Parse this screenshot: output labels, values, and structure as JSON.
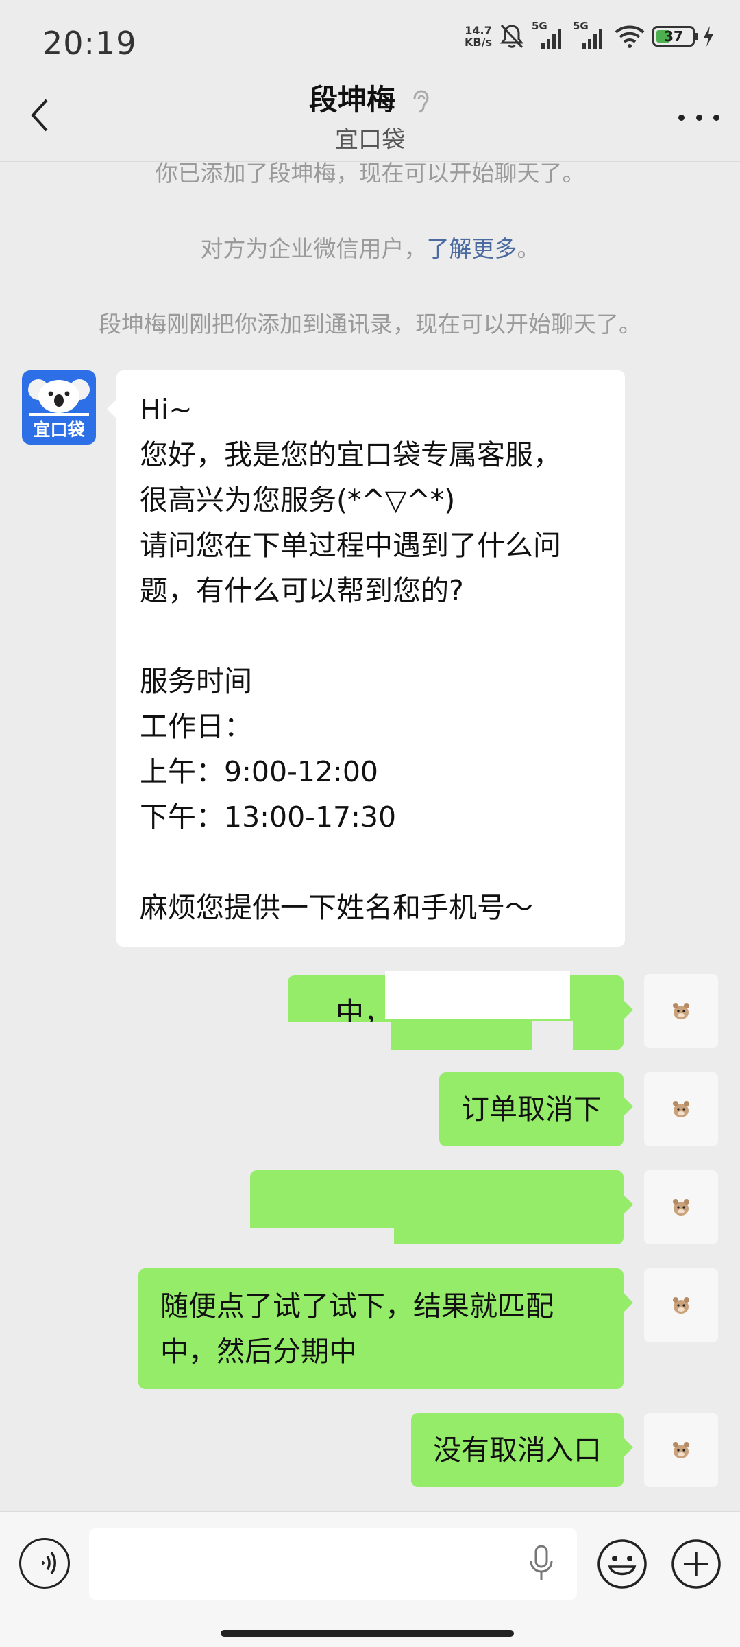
{
  "status_bar": {
    "time": "20:19",
    "net_speed_value": "14.7",
    "net_speed_unit": "KB/s",
    "signal_1_label": "5G",
    "signal_2_label": "5G",
    "battery": "37"
  },
  "header": {
    "title": "段坤梅",
    "subtitle": "宜口袋"
  },
  "system_messages": {
    "added_friend": "你已添加了段坤梅，现在可以开始聊天了。",
    "enterprise_prefix": "对方为企业微信用户，",
    "enterprise_link": "了解更多",
    "enterprise_suffix": "。",
    "added_to_contacts": "段坤梅刚刚把你添加到通讯录，现在可以开始聊天了。"
  },
  "contact_avatar_text": "宜口袋",
  "incoming_message": {
    "lines": [
      "Hi~",
      "您好，我是您的宜口袋专属客服，",
      "很高兴为您服务(*^▽^*)",
      "请问您在下单过程中遇到了什么问",
      "题，有什么可以帮到您的?",
      "",
      "服务时间",
      "工作日：",
      "上午：9:00-12:00",
      "下午：13:00-17:30",
      "",
      "麻烦您提供一下姓名和手机号～"
    ]
  },
  "outgoing_messages": [
    {
      "text": "中，"
    },
    {
      "text": "订单取消下"
    },
    {
      "text": ""
    },
    {
      "text_line1": "随便点了试了试下，结果就匹配",
      "text_line2": "中，然后分期中"
    },
    {
      "text": "没有取消入口"
    }
  ],
  "colors": {
    "background": "#ececec",
    "outgoing_bubble": "#95ec69",
    "incoming_bubble": "#ffffff",
    "link": "#4a6aa0",
    "avatar_brand": "#2c6fe6"
  },
  "icons": {
    "back": "chevron-left-icon",
    "ear": "ear-icon",
    "more": "more-horizontal-icon",
    "voice": "voice-icon",
    "mic": "mic-icon",
    "emoji": "emoji-icon",
    "plus": "plus-icon"
  }
}
